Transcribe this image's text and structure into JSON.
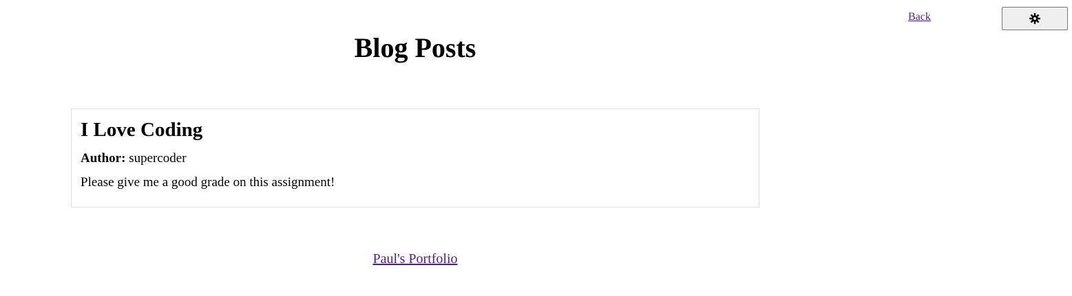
{
  "header": {
    "back_label": "Back",
    "theme_toggle_icon": "gear-icon"
  },
  "main": {
    "title": "Blog Posts",
    "posts": [
      {
        "title": "I Love Coding",
        "author_label": "Author:",
        "author": "supercoder",
        "body": "Please give me a good grade on this assignment!"
      }
    ]
  },
  "footer": {
    "link_label": "Paul's Portfolio"
  },
  "colors": {
    "link_visited": "#551a8b",
    "card_border": "#dddddd",
    "button_bg": "#efefef"
  }
}
